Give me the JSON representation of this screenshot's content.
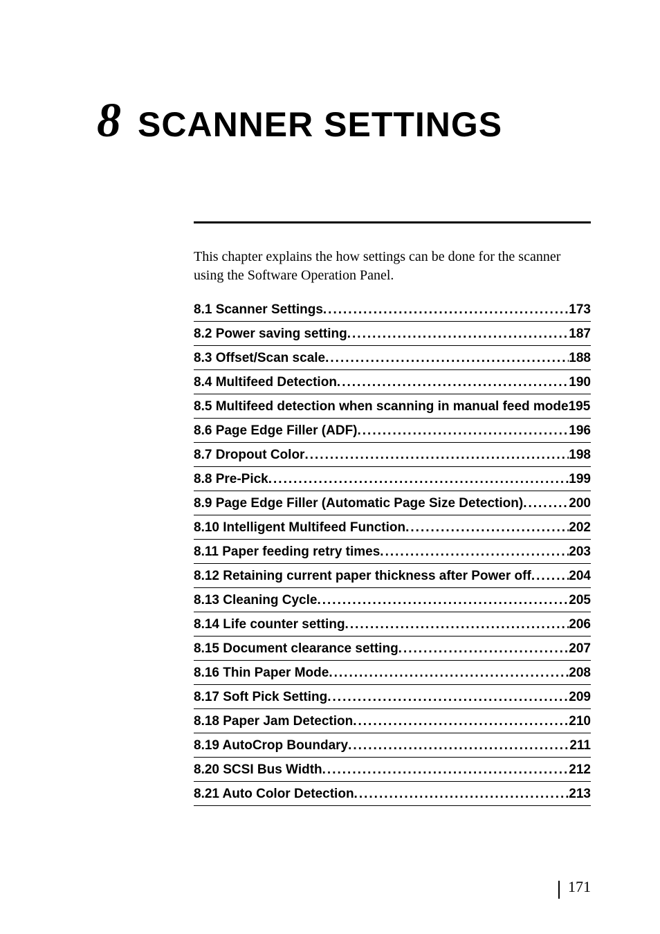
{
  "chapter": {
    "number": "8",
    "title": "SCANNER SETTINGS"
  },
  "intro": "This chapter explains the how settings can be done for the scanner using the Software Operation Panel.",
  "toc": [
    {
      "title": "8.1 Scanner Settings ",
      "page": "173",
      "leader": true
    },
    {
      "title": "8.2 Power saving setting",
      "page": "187",
      "leader": true
    },
    {
      "title": "8.3 Offset/Scan scale",
      "page": "188",
      "leader": true
    },
    {
      "title": "8.4 Multifeed Detection ",
      "page": "190",
      "leader": true
    },
    {
      "title": "8.5 Multifeed detection when scanning in manual feed mode",
      "page": "195",
      "leader": false
    },
    {
      "title": "8.6 Page Edge Filler (ADF)",
      "page": "196",
      "leader": true
    },
    {
      "title": "8.7 Dropout Color ",
      "page": "198",
      "leader": true
    },
    {
      "title": "8.8 Pre-Pick ",
      "page": "199",
      "leader": true
    },
    {
      "title": "8.9 Page Edge Filler (Automatic Page Size Detection) ",
      "page": "200",
      "leader": true
    },
    {
      "title": "8.10 Intelligent Multifeed Function",
      "page": "202",
      "leader": true
    },
    {
      "title": "8.11 Paper feeding retry times",
      "page": "203",
      "leader": true
    },
    {
      "title": "8.12 Retaining current paper thickness after Power off ",
      "page": "204",
      "leader": true
    },
    {
      "title": "8.13 Cleaning Cycle",
      "page": "205",
      "leader": true
    },
    {
      "title": "8.14 Life counter setting ",
      "page": "206",
      "leader": true
    },
    {
      "title": "8.15 Document clearance setting",
      "page": "207",
      "leader": true
    },
    {
      "title": "8.16 Thin Paper Mode",
      "page": "208",
      "leader": true
    },
    {
      "title": "8.17 Soft Pick Setting ",
      "page": "209",
      "leader": true
    },
    {
      "title": "8.18 Paper Jam Detection ",
      "page": "210",
      "leader": true
    },
    {
      "title": "8.19 AutoCrop Boundary ",
      "page": "211",
      "leader": true
    },
    {
      "title": "8.20 SCSI Bus Width ",
      "page": "212",
      "leader": true
    },
    {
      "title": "8.21 Auto Color Detection",
      "page": "213",
      "leader": true
    }
  ],
  "footer": {
    "page": "171"
  }
}
